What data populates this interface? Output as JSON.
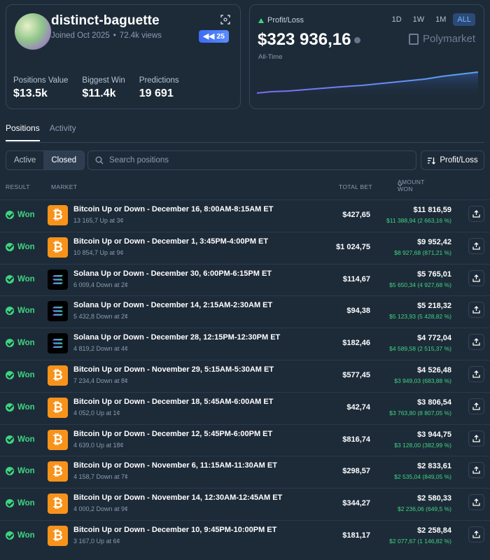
{
  "profile": {
    "username": "distinct-baguette",
    "joined": "Joined Oct 2025",
    "views": "72.4k views",
    "badge": "25",
    "stats": [
      {
        "label": "Positions Value",
        "value": "$13.5k"
      },
      {
        "label": "Biggest Win",
        "value": "$11.4k"
      },
      {
        "label": "Predictions",
        "value": "19 691"
      }
    ]
  },
  "pnl": {
    "label": "Profit/Loss",
    "value": "$323 936,16",
    "period_label": "All-Time",
    "brand": "Polymarket",
    "ranges": [
      "1D",
      "1W",
      "1M",
      "ALL"
    ],
    "active_range": "ALL",
    "colors": {
      "line_start": "#7b6cf0",
      "line_end": "#5aa6f0",
      "up": "#3ed57e"
    }
  },
  "tabs": [
    "Positions",
    "Activity"
  ],
  "active_tab": "Positions",
  "filters": {
    "active": "Active",
    "closed": "Closed"
  },
  "search": {
    "placeholder": "Search positions"
  },
  "sort": {
    "label": "Profit/Loss"
  },
  "columns": {
    "result": "RESULT",
    "market": "MARKET",
    "total_bet": "TOTAL BET",
    "amount_won": "AMOUNT WON"
  },
  "rows": [
    {
      "result": "Won",
      "coin": "btc",
      "title": "Bitcoin Up or Down - December 16, 8:00AM-8:15AM ET",
      "sub": "13 165,7 Up at 3¢",
      "total_bet": "$427,65",
      "amount_won": "$11 816,59",
      "gain": "$11 388,94 (2 663,16 %)"
    },
    {
      "result": "Won",
      "coin": "btc",
      "title": "Bitcoin Up or Down - December 1, 3:45PM-4:00PM ET",
      "sub": "10 854,7 Up at 9¢",
      "total_bet": "$1 024,75",
      "amount_won": "$9 952,42",
      "gain": "$8 927,68 (871,21 %)"
    },
    {
      "result": "Won",
      "coin": "sol",
      "title": "Solana Up or Down - December 30, 6:00PM-6:15PM ET",
      "sub": "6 009,4 Down at 2¢",
      "total_bet": "$114,67",
      "amount_won": "$5 765,01",
      "gain": "$5 650,34 (4 927,68 %)"
    },
    {
      "result": "Won",
      "coin": "sol",
      "title": "Solana Up or Down - December 14, 2:15AM-2:30AM ET",
      "sub": "5 432,8 Down at 2¢",
      "total_bet": "$94,38",
      "amount_won": "$5 218,32",
      "gain": "$5 123,93 (5 428,82 %)"
    },
    {
      "result": "Won",
      "coin": "sol",
      "title": "Solana Up or Down - December 28, 12:15PM-12:30PM ET",
      "sub": "4 819,2 Down at 4¢",
      "total_bet": "$182,46",
      "amount_won": "$4 772,04",
      "gain": "$4 589,58 (2 515,37 %)"
    },
    {
      "result": "Won",
      "coin": "btc",
      "title": "Bitcoin Up or Down - November 29, 5:15AM-5:30AM ET",
      "sub": "7 234,4 Down at 8¢",
      "total_bet": "$577,45",
      "amount_won": "$4 526,48",
      "gain": "$3 949,03 (683,88 %)"
    },
    {
      "result": "Won",
      "coin": "btc",
      "title": "Bitcoin Up or Down - December 18, 5:45AM-6:00AM ET",
      "sub": "4 052,0 Up at 1¢",
      "total_bet": "$42,74",
      "amount_won": "$3 806,54",
      "gain": "$3 763,80 (8 807,05 %)"
    },
    {
      "result": "Won",
      "coin": "btc",
      "title": "Bitcoin Up or Down - December 12, 5:45PM-6:00PM ET",
      "sub": "4 639,0 Up at 18¢",
      "total_bet": "$816,74",
      "amount_won": "$3 944,75",
      "gain": "$3 128,00 (382,99 %)"
    },
    {
      "result": "Won",
      "coin": "btc",
      "title": "Bitcoin Up or Down - November 6, 11:15AM-11:30AM ET",
      "sub": "4 158,7 Down at 7¢",
      "total_bet": "$298,57",
      "amount_won": "$2 833,61",
      "gain": "$2 535,04 (849,05 %)"
    },
    {
      "result": "Won",
      "coin": "btc",
      "title": "Bitcoin Up or Down - November 14, 12:30AM-12:45AM ET",
      "sub": "4 000,2 Down at 9¢",
      "total_bet": "$344,27",
      "amount_won": "$2 580,33",
      "gain": "$2 236,06 (649,5 %)"
    },
    {
      "result": "Won",
      "coin": "btc",
      "title": "Bitcoin Up or Down - December 10, 9:45PM-10:00PM ET",
      "sub": "3 167,0 Up at 6¢",
      "total_bet": "$181,17",
      "amount_won": "$2 258,84",
      "gain": "$2 077,67 (1 146,82 %)"
    }
  ]
}
